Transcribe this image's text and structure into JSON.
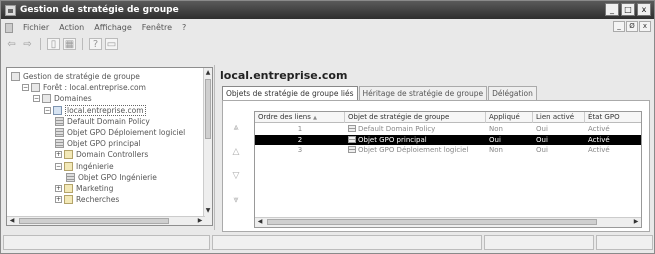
{
  "window": {
    "title": "Gestion de stratégie de groupe"
  },
  "title_controls": [
    "_",
    "□",
    "x"
  ],
  "menu": [
    "Fichier",
    "Action",
    "Affichage",
    "Fenêtre",
    "?"
  ],
  "mdi_controls": [
    "_",
    "Ø",
    "x"
  ],
  "tree": [
    {
      "label": "Gestion de stratégie de groupe",
      "level": 0,
      "icon": "gpmc-icon"
    },
    {
      "label": "Forêt : local.entreprise.com",
      "level": 1,
      "expander": "−",
      "icon": "forest-icon"
    },
    {
      "label": "Domaines",
      "level": 2,
      "expander": "−",
      "icon": "domains-icon"
    },
    {
      "label": "local.entreprise.com",
      "level": 3,
      "expander": "−",
      "icon": "domain-icon",
      "selected": true
    },
    {
      "label": "Default Domain Policy",
      "level": 4,
      "icon": "gpo-link-icon"
    },
    {
      "label": "Objet GPO Déploiement logiciel",
      "level": 4,
      "icon": "gpo-link-icon"
    },
    {
      "label": "Objet GPO principal",
      "level": 4,
      "icon": "gpo-link-icon"
    },
    {
      "label": "Domain Controllers",
      "level": 4,
      "expander": "+",
      "icon": "ou-icon"
    },
    {
      "label": "Ingénierie",
      "level": 4,
      "expander": "−",
      "icon": "ou-icon"
    },
    {
      "label": "Objet GPO Ingénierie",
      "level": 5,
      "icon": "gpo-link-icon"
    },
    {
      "label": "Marketing",
      "level": 4,
      "expander": "+",
      "icon": "ou-icon"
    },
    {
      "label": "Recherches",
      "level": 4,
      "expander": "+",
      "icon": "ou-icon"
    }
  ],
  "right_title": "local.entreprise.com",
  "tabs": [
    {
      "label": "Objets de stratégie de groupe liés",
      "active": true
    },
    {
      "label": "Héritage de stratégie de groupe",
      "active": false
    },
    {
      "label": "Délégation",
      "active": false
    }
  ],
  "columns": [
    "Ordre des liens",
    "Objet de stratégie de groupe",
    "Appliqué",
    "Lien activé",
    "État GPO"
  ],
  "sort_indicator": "▲",
  "rows": [
    {
      "order": "1",
      "gpo": "Default Domain Policy",
      "applied": "Non",
      "link_enabled": "Oui",
      "state": "Activé",
      "selected": false
    },
    {
      "order": "2",
      "gpo": "Objet GPO principal",
      "applied": "Oui",
      "link_enabled": "Oui",
      "state": "Activé",
      "selected": true
    },
    {
      "order": "3",
      "gpo": "Objet GPO Déploiement logiciel",
      "applied": "Non",
      "link_enabled": "Oui",
      "state": "Activé",
      "selected": false
    }
  ]
}
